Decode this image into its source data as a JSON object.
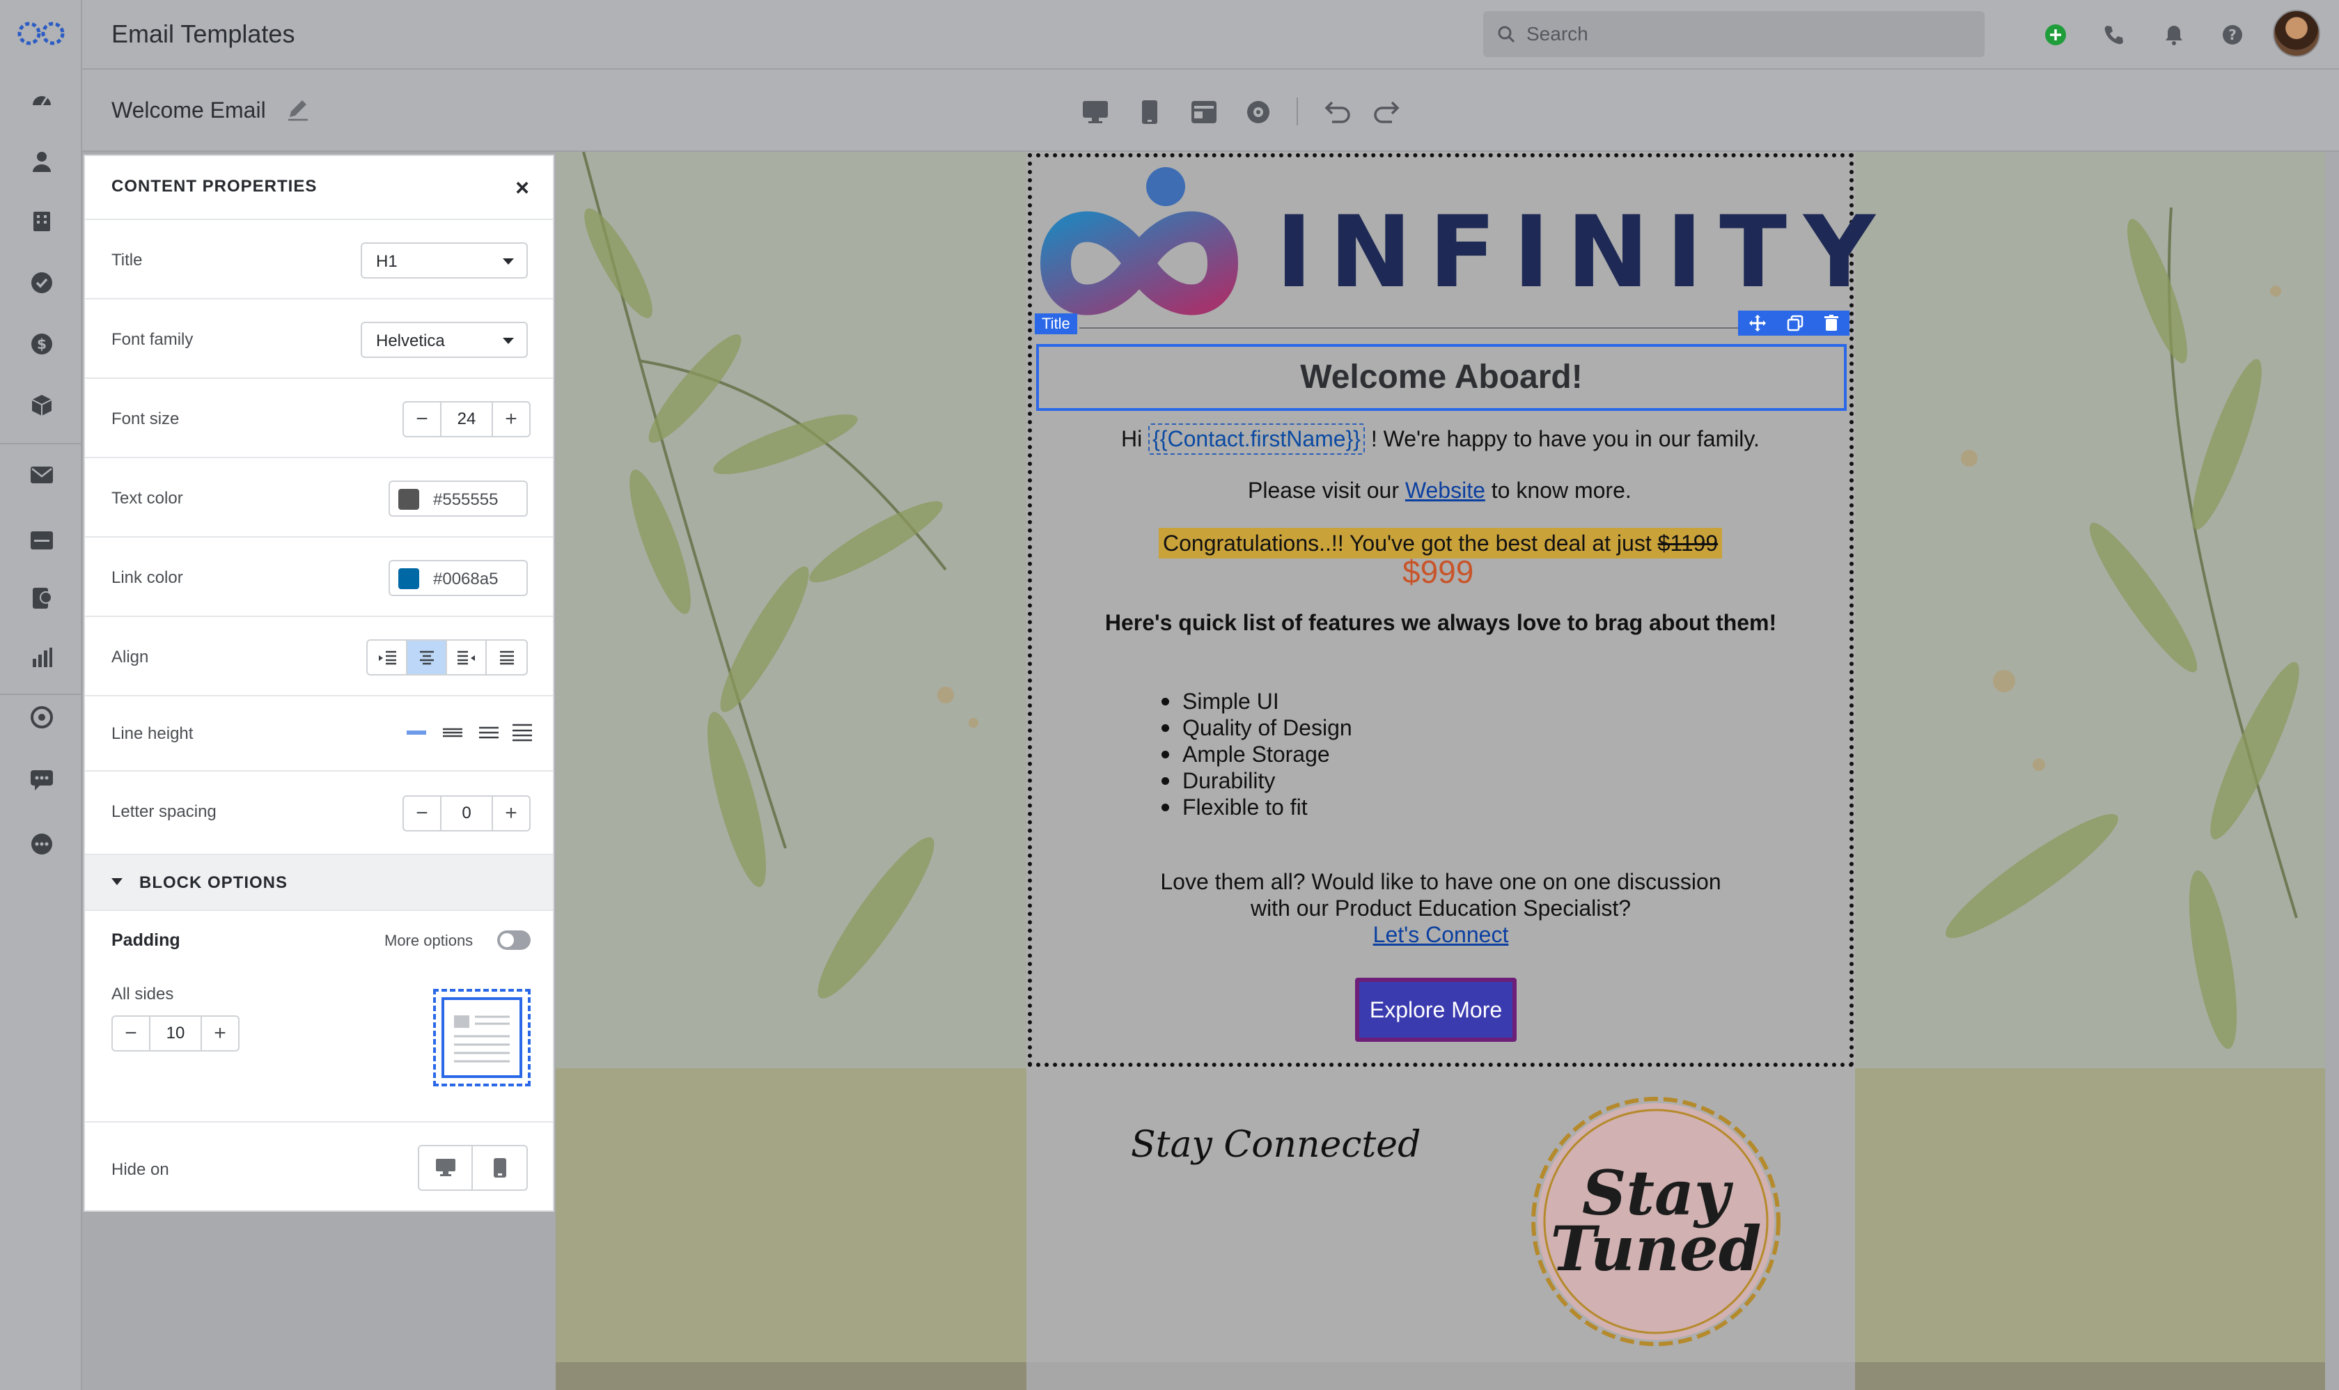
{
  "app": {
    "title": "Email Templates",
    "search_placeholder": "Search"
  },
  "nav": {
    "icons": [
      "dashboard-icon",
      "contacts-icon",
      "companies-icon",
      "tasks-icon",
      "deals-icon",
      "products-icon",
      "email-icon",
      "inbox-icon",
      "forms-icon",
      "reports-icon",
      "automation-icon",
      "chat-icon",
      "more-icon"
    ]
  },
  "header_actions": [
    "add-icon",
    "phone-icon",
    "bell-icon",
    "help-icon"
  ],
  "editor": {
    "template_name": "Welcome Email",
    "toolbar": [
      "desktop-icon",
      "mobile-icon",
      "template-icon",
      "preview-icon",
      "undo-icon",
      "redo-icon"
    ]
  },
  "panel": {
    "title": "CONTENT PROPERTIES",
    "close": "×",
    "title_label": "Title",
    "title_value": "H1",
    "font_family_label": "Font family",
    "font_family_value": "Helvetica",
    "font_size_label": "Font size",
    "font_size_value": "24",
    "text_color_label": "Text color",
    "text_color_value": "#555555",
    "link_color_label": "Link color",
    "link_color_value": "#0068a5",
    "align_label": "Align",
    "align_selected": "center",
    "line_height_label": "Line height",
    "letter_spacing_label": "Letter spacing",
    "letter_spacing_value": "0",
    "block_options_title": "BLOCK OPTIONS",
    "padding_label": "Padding",
    "more_options_label": "More options",
    "more_options_on": false,
    "all_sides_label": "All sides",
    "padding_value": "10",
    "hide_on_label": "Hide on",
    "minus": "−",
    "plus": "+"
  },
  "email": {
    "brand": "INFINITY",
    "title_tag": "Title",
    "heading": "Welcome Aboard!",
    "greeting_pre": "Hi",
    "greeting_tag": "{{Contact.firstName}}",
    "greeting_post": "! We're happy to have you in our family.",
    "visit_pre": "Please visit our",
    "visit_link": "Website",
    "visit_post": "to know more.",
    "promo_text": "Congratulations..!! You've got the best deal at just",
    "promo_old_price": "$1199",
    "promo_price": "$999",
    "features_heading": "Here's quick list of features we always love to brag about them!",
    "features": [
      "Simple UI",
      "Quality of Design",
      "Ample Storage",
      "Durability",
      "Flexible to fit"
    ],
    "discussion_line1": "Love them all? Would like to have one on one discussion",
    "discussion_line2": "with our Product Education Specialist?",
    "connect_link": "Let's Connect",
    "cta_label": "Explore More",
    "stay_connected": "Stay Connected",
    "badge_line1": "Stay",
    "badge_line2": "Tuned"
  },
  "colors": {
    "accent": "#2a68e8",
    "text_color": "#555555",
    "link_color": "#0068a5",
    "cta_bg": "#3b3bb0",
    "cta_border": "#6c1e79",
    "highlight": "#c9a23a",
    "price": "#c8552a"
  }
}
